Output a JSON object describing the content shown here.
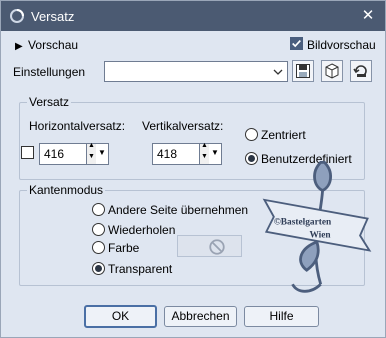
{
  "window": {
    "title": "Versatz"
  },
  "top": {
    "preview_label": "Vorschau",
    "image_preview_label": "Bildvorschau",
    "image_preview_checked": true,
    "settings_label": "Einstellungen",
    "settings_value": ""
  },
  "offset": {
    "group_label": "Versatz",
    "horizontal_label": "Horizontalversatz:",
    "vertical_label": "Vertikalversatz:",
    "horizontal_value": "416",
    "vertical_value": "418",
    "centered_label": "Zentriert",
    "custom_label": "Benutzerdefiniert",
    "selected": "custom"
  },
  "edge_mode": {
    "group_label": "Kantenmodus",
    "options": [
      {
        "label": "Andere Seite übernehmen",
        "checked": false
      },
      {
        "label": "Wiederholen",
        "checked": false
      },
      {
        "label": "Farbe",
        "checked": false
      },
      {
        "label": "Transparent",
        "checked": true
      }
    ]
  },
  "watermark": {
    "text_line1": "©Bastelgarten",
    "text_line2": "Wien"
  },
  "buttons": {
    "ok": "OK",
    "cancel": "Abbrechen",
    "help": "Hilfe"
  },
  "icons": {
    "app": "app-swirl-icon",
    "close": "close-icon",
    "save": "save-icon",
    "reset": "cube-icon",
    "load": "restore-icon",
    "dropdown": "chevron-down-icon",
    "forbidden": "no-color-icon"
  }
}
